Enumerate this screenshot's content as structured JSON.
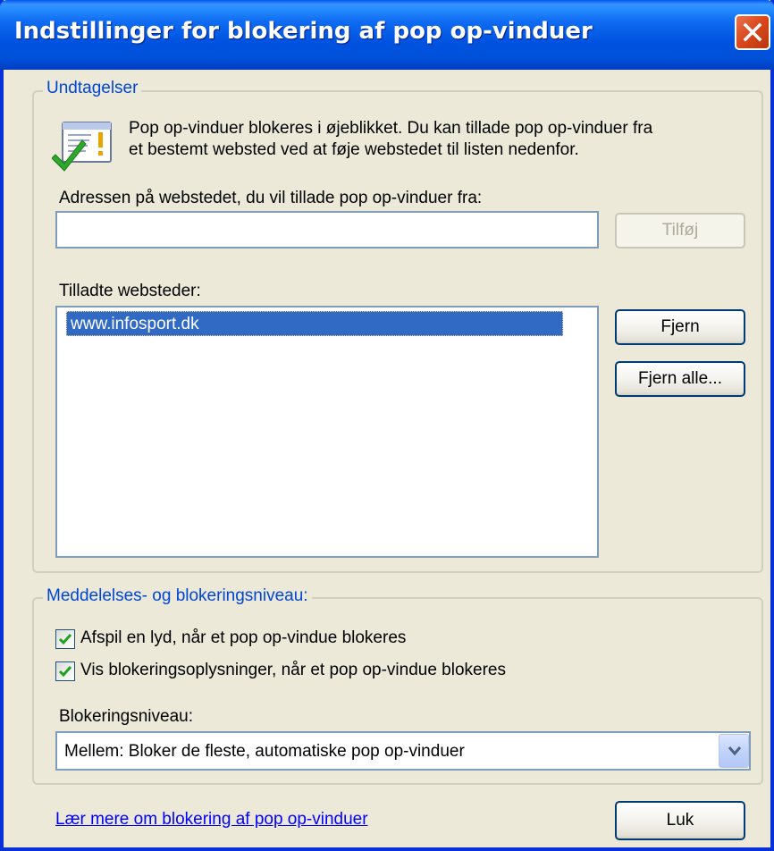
{
  "window": {
    "title": "Indstillinger for blokering af pop op-vinduer",
    "icons": {
      "close": "close-icon"
    }
  },
  "exceptions": {
    "legend": "Undtagelser",
    "info_icon": "popup-blocker-info-icon",
    "info_line1": "Pop op-vinduer blokeres i øjeblikket. Du kan tillade pop op-vinduer fra",
    "info_line2": "et bestemt websted ved at føje webstedet til listen nedenfor.",
    "address_label": "Adressen på webstedet, du vil tillade pop op-vinduer fra:",
    "address_value": "",
    "add_button": "Tilføj",
    "allowed_label": "Tilladte websteder:",
    "allowed_sites": [
      "www.infosport.dk"
    ],
    "remove_button": "Fjern",
    "remove_all_button": "Fjern alle..."
  },
  "notification": {
    "legend": "Meddelelses- og blokeringsniveau:",
    "play_sound": {
      "label": "Afspil en lyd, når et pop op-vindue blokeres",
      "checked": true
    },
    "show_info": {
      "label": "Vis blokeringsoplysninger, når et pop op-vindue blokeres",
      "checked": true
    },
    "level_label": "Blokeringsniveau:",
    "level_value": "Mellem: Bloker de fleste, automatiske pop op-vinduer"
  },
  "footer": {
    "learn_more": "Lær mere om blokering af pop op-vinduer",
    "close_button": "Luk"
  },
  "colors": {
    "accent": "#0046D5",
    "selection": "#316AC5",
    "titlebar": "#0050D8",
    "close": "#D9461A"
  }
}
